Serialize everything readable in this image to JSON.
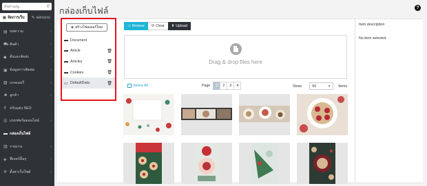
{
  "sidebar": {
    "search_placeholder": "ค้นหาเมนู...",
    "tabs": [
      {
        "label": "จัดการเว็บ",
        "icon": "grid-icon"
      },
      {
        "label": "ออกแบบ",
        "icon": "brush-icon"
      }
    ],
    "items": [
      {
        "label": "บทความ",
        "icon": "document-icon",
        "chevron": "‹"
      },
      {
        "label": "สินค้า",
        "icon": "cart-icon",
        "chevron": "‹"
      },
      {
        "label": "สั่งและจัดส่ง",
        "icon": "tag-icon",
        "chevron": "‹"
      },
      {
        "label": "ข้อมูลการติดต่อ",
        "icon": "inbox-icon",
        "chevron": "‹"
      },
      {
        "label": "แกลเลอรี่",
        "icon": "image-icon",
        "chevron": "‹"
      },
      {
        "label": "ลูกค้า",
        "icon": "users-icon",
        "chevron": "‹"
      },
      {
        "label": "ปรับแต่ง SEO",
        "icon": "search-icon",
        "chevron": ""
      },
      {
        "label": "แบบฟอร์มออนไลน์",
        "icon": "form-icon",
        "chevron": "‹"
      },
      {
        "label": "กล่องเก็บไฟล์",
        "icon": "folder-icon",
        "chevron": "",
        "active": true
      },
      {
        "label": "รายงาน",
        "icon": "chart-icon",
        "chevron": "‹"
      },
      {
        "label": "ฟีเจอร์อื่นๆ",
        "icon": "cube-icon",
        "chevron": "‹"
      },
      {
        "label": "ตั้งค่าเว็บไซต์",
        "icon": "gear-icon",
        "chevron": "‹"
      }
    ]
  },
  "page": {
    "title": "กล่องเก็บไฟล์",
    "help_glyph": "?"
  },
  "folders": {
    "new_folder_label": "สร้างโฟลเดอร์ใหม่",
    "items": [
      {
        "name": "Document",
        "deletable": false,
        "selected": false
      },
      {
        "name": "Article",
        "deletable": true,
        "selected": false
      },
      {
        "name": "Articles",
        "deletable": true,
        "selected": false
      },
      {
        "name": "Cookies",
        "deletable": true,
        "selected": false
      },
      {
        "name": "DefaultData",
        "deletable": true,
        "selected": true
      }
    ]
  },
  "toolbar": {
    "browse_label": "Browse",
    "clear_label": "Clear",
    "upload_label": "Upload"
  },
  "dropzone": {
    "text": "Drag & drop files here"
  },
  "listing": {
    "select_all_label": "Select All",
    "page_label": "Page",
    "pages": [
      "1",
      "2",
      "3",
      "4"
    ],
    "current_page": "1",
    "show_label": "Show",
    "show_value": "50",
    "items_label": "Items"
  },
  "details": {
    "title": "Item description",
    "empty_text": "No item selected."
  },
  "colors": {
    "sidebar_bg": "#2f3338",
    "browse_bg": "#1fb5d7",
    "upload_bg": "#2d3035",
    "highlight_border": "#e3121a",
    "link": "#2a9fd6"
  }
}
